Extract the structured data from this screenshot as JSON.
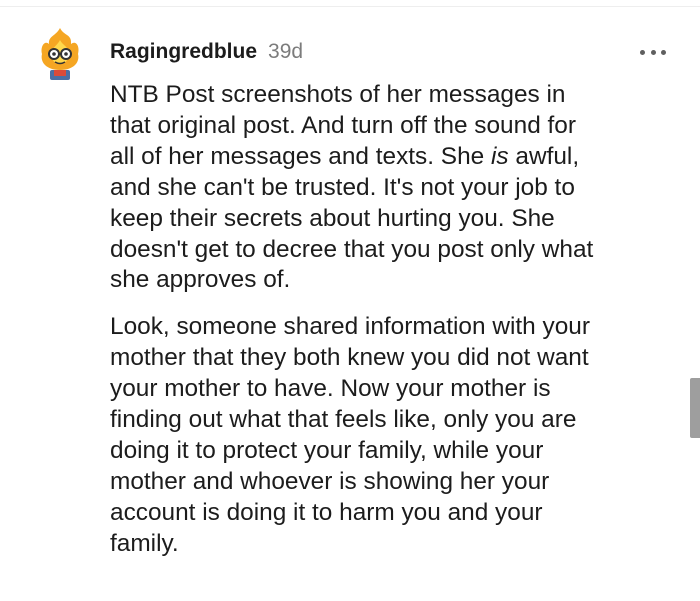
{
  "comment": {
    "username": "Ragingredblue",
    "timestamp": "39d",
    "avatar_icon": "flame-avatar-icon",
    "menu_icon": "more-options-icon",
    "paragraphs": [
      {
        "lines": [
          [
            "NTB Post screenshots of her messages in"
          ],
          [
            "that original post. And turn off the sound for"
          ],
          [
            "all of her messages and texts. She ",
            "is",
            " awful,"
          ],
          [
            "and she can't be trusted. It's not your job to"
          ],
          [
            "keep their secrets about hurting you. She"
          ],
          [
            "doesn't get to decree that you post only what"
          ],
          [
            "she approves of."
          ]
        ]
      },
      {
        "lines": [
          [
            "Look, someone shared information with your"
          ],
          [
            "mother that they both knew you did not want"
          ],
          [
            "your mother to have. Now your mother is"
          ],
          [
            "finding out what that feels like, only you are"
          ],
          [
            "doing it to protect your family, while your"
          ],
          [
            "mother and whoever is showing her your"
          ],
          [
            "account is doing it to harm you and your"
          ],
          [
            "family."
          ]
        ]
      }
    ]
  },
  "colors": {
    "text": "#1c1c1c",
    "meta": "#7c7c7c",
    "icon": "#5f5f5f",
    "scrollbar": "#9e9e9e",
    "avatar_flame": "#f5a623",
    "avatar_flame_inner": "#ffd84d"
  }
}
